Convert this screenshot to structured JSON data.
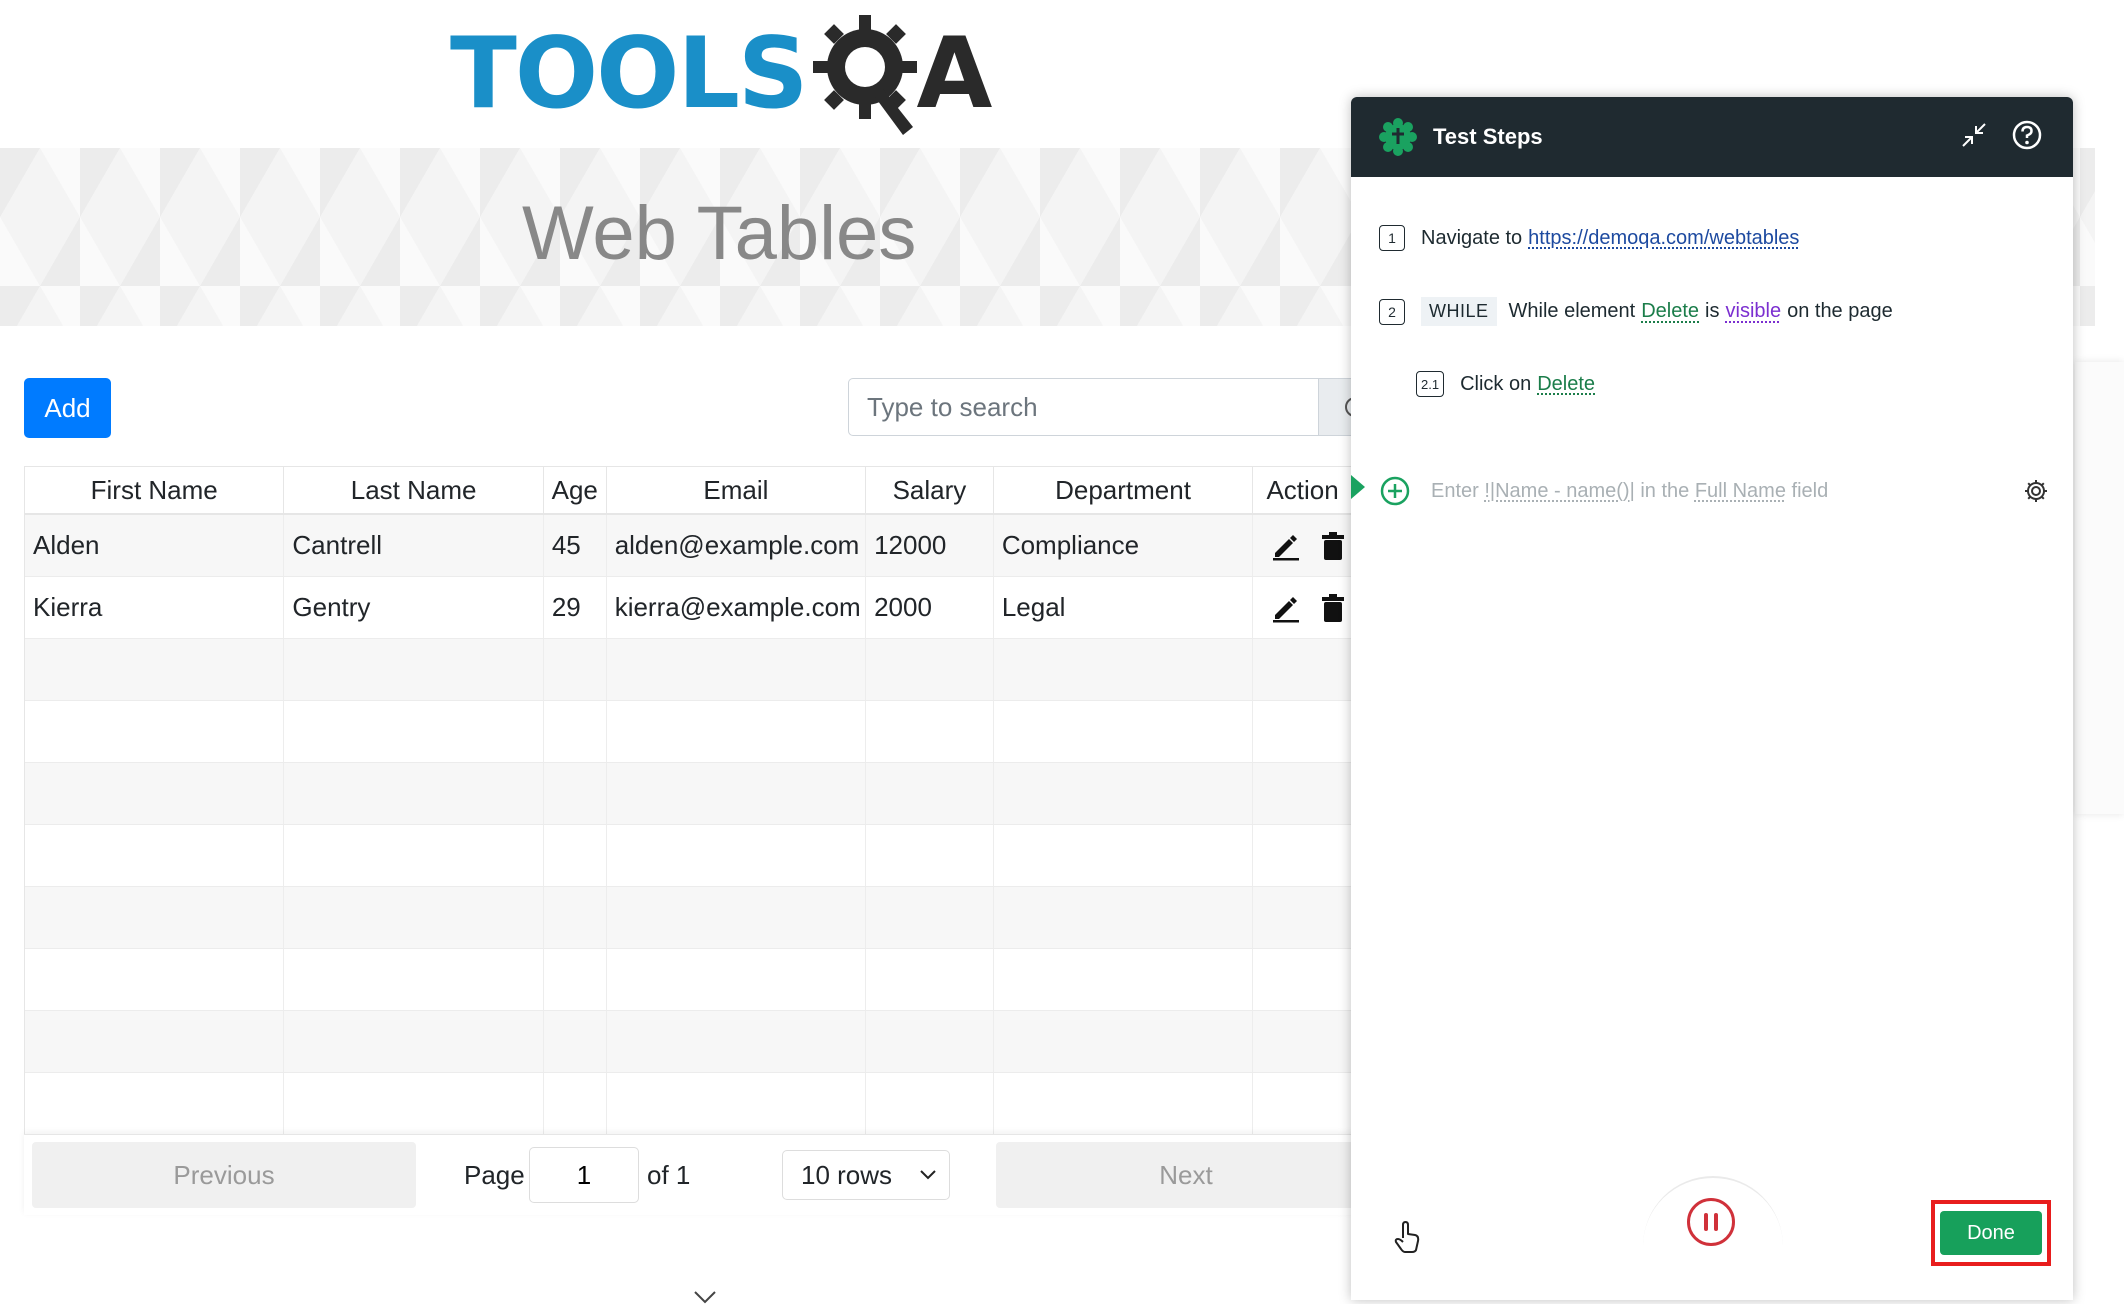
{
  "logo": {
    "text": "TOOLS",
    "suffix": "A"
  },
  "banner": {
    "title": "Web Tables"
  },
  "toolbar": {
    "add_label": "Add",
    "search_placeholder": "Type to search"
  },
  "table": {
    "columns": [
      "First Name",
      "Last Name",
      "Age",
      "Email",
      "Salary",
      "Department",
      "Action"
    ],
    "rows": [
      [
        "Alden",
        "Cantrell",
        "45",
        "alden@example.com",
        "12000",
        "Compliance"
      ],
      [
        "Kierra",
        "Gentry",
        "29",
        "kierra@example.com",
        "2000",
        "Legal"
      ]
    ]
  },
  "pagination": {
    "previous": "Previous",
    "page_label": "Page",
    "page_value": "1",
    "of_label": "of 1",
    "rows_selected": "10 rows",
    "next": "Next"
  },
  "panel": {
    "title": "Test Steps",
    "steps": [
      {
        "num": "1",
        "prefix": "Navigate to",
        "url": "https://demoqa.com/webtables"
      },
      {
        "num": "2",
        "keyword": "WHILE",
        "prefix": "While element",
        "element": "Delete",
        "mid": "is",
        "condition": "visible",
        "suffix": "on the page"
      },
      {
        "num": "2.1",
        "prefix": "Click on",
        "element": "Delete"
      }
    ],
    "new_step": {
      "p1": "Enter ",
      "p2": "!|Name - name()|",
      "p3": " in the ",
      "p4": "Full Name",
      "p5": " field"
    },
    "done_label": "Done"
  },
  "colors": {
    "brand_blue": "#1a8fc8",
    "add_button": "#007bff",
    "panel_header": "#1f2a30",
    "done_green": "#17a05b",
    "highlight_red": "#e81d1d",
    "pause_red": "#d0313a"
  }
}
